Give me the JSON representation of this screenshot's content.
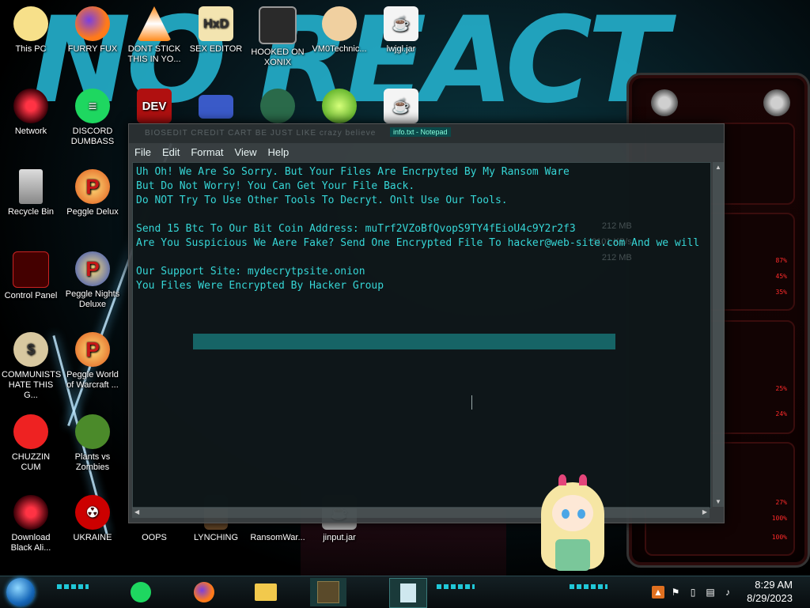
{
  "wallpaper": {
    "big_text": "NO REACT"
  },
  "desktop_icons": [
    {
      "label": "This PC",
      "icon": "this-pc-icon"
    },
    {
      "label": "FURRY FUX",
      "icon": "firefox-icon"
    },
    {
      "label": "DONT STICK THIS IN YO...",
      "icon": "vlc-cone-icon"
    },
    {
      "label": "SEX EDITOR",
      "icon": "hxd-icon"
    },
    {
      "label": "HOOKED ON XONIX",
      "icon": "xonix-icon"
    },
    {
      "label": "VM0Technic...",
      "icon": "doctor-icon"
    },
    {
      "label": "lwjgl.jar",
      "icon": "java-icon"
    },
    {
      "label": "Network",
      "icon": "alien-orb-icon"
    },
    {
      "label": "DISCORD DUMBASS",
      "icon": "spotify-icon"
    },
    {
      "label": "",
      "icon": "dev-cpp-icon",
      "badge": "DEV"
    },
    {
      "label": "",
      "icon": "card-icon"
    },
    {
      "label": "",
      "icon": "santa-icon"
    },
    {
      "label": "",
      "icon": "lime-icon"
    },
    {
      "label": "",
      "icon": "java-icon"
    },
    {
      "label": "Recycle Bin",
      "icon": "recycle-bin-icon"
    },
    {
      "label": "Peggle Delux",
      "icon": "peggle-icon"
    },
    {
      "label": "Control Panel",
      "icon": "control-panel-icon"
    },
    {
      "label": "Peggle Nights Deluxe",
      "icon": "peggle-icon"
    },
    {
      "label": "COMMUNISTS HATE THIS G...",
      "icon": "money-bag-icon"
    },
    {
      "label": "Peggle World of Warcraft ...",
      "icon": "peggle-icon"
    },
    {
      "label": "CHUZZIN CUM",
      "icon": "chuzzle-icon"
    },
    {
      "label": "Plants vs Zombies",
      "icon": "plants-icon"
    },
    {
      "label": "Download Black Ali...",
      "icon": "alien-orb-icon"
    },
    {
      "label": "UKRAINE",
      "icon": "radiation-icon"
    },
    {
      "label": "OOPS",
      "icon": "blank-icon"
    },
    {
      "label": "LYNCHING",
      "icon": "book-icon"
    },
    {
      "label": "RansomWar...",
      "icon": "blank-icon"
    },
    {
      "label": "jinput.jar",
      "icon": "java-icon"
    }
  ],
  "notepad": {
    "title": "info.txt - Notepad",
    "ghost_title": "BIOSEDIT   CREDIT CART   BE JUST LIKE   crazy   believe",
    "menu": [
      "File",
      "Edit",
      "Format",
      "View",
      "Help"
    ],
    "ghost_stats": [
      "212 MB",
      "3101 KB/s",
      "212 MB"
    ],
    "lines": [
      "Uh Oh! We Are So Sorry. But Your Files Are Encrpyted By My Ransom Ware",
      "But Do Not Worry! You Can Get Your File Back.",
      "Do NOT Try To Use Other Tools To Decryt. Onlt Use Our Tools.",
      "",
      "Send 15 Btc To Our Bit Coin Address: muTrf2VZoBfQvopS9TY4fEioU4c9Y2r2f3",
      "Are You Suspicious We Aere Fake? Send One Encrypted File To hacker@web-site.com And we will",
      "",
      "Our Support Site: mydecrytpsite.onion",
      "You Files Were Encrypted By Hacker Group"
    ]
  },
  "gadget": {
    "values": [
      "87%",
      "45%",
      "35%",
      "25%",
      "24%",
      "27%",
      "100%",
      "100%"
    ]
  },
  "taskbar": {
    "apps": [
      "spotify-icon",
      "firefox-icon",
      "file-explorer-icon",
      "minecraft-icon",
      "notepad-icon"
    ],
    "tray": [
      "firewall-icon",
      "flag-icon",
      "action-center-icon",
      "network-icon",
      "volume-icon"
    ],
    "time": "8:29 AM",
    "date": "8/29/2023"
  }
}
